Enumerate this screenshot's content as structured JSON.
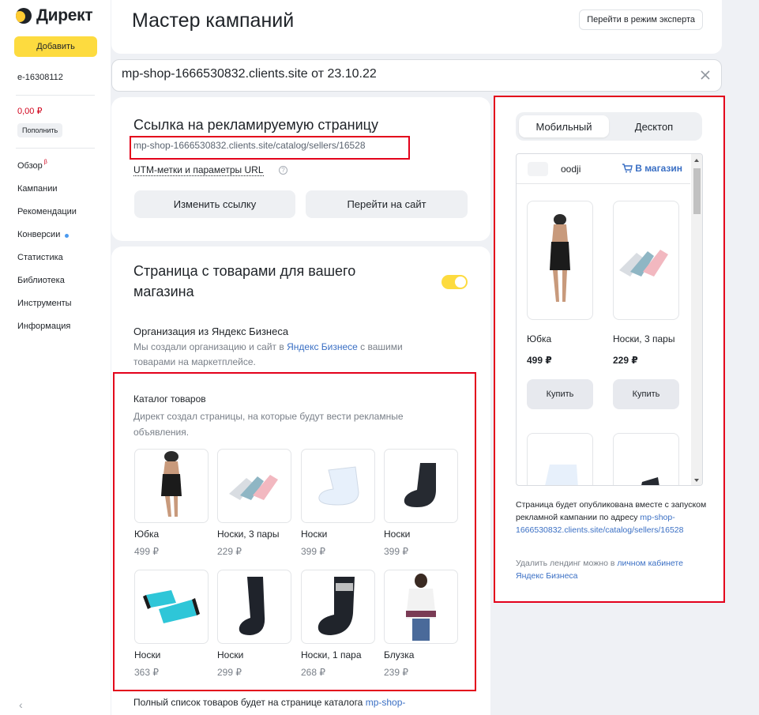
{
  "sidebar": {
    "logo": "Директ",
    "add_button": "Добавить",
    "login": "e-16308112",
    "balance": "0,00 ₽",
    "topup_button": "Пополнить",
    "nav": [
      {
        "label": "Обзор",
        "badge": "β"
      },
      {
        "label": "Кампании"
      },
      {
        "label": "Рекомендации"
      },
      {
        "label": "Конверсии",
        "dot": true
      },
      {
        "label": "Статистика"
      },
      {
        "label": "Библиотека"
      },
      {
        "label": "Инструменты"
      },
      {
        "label": "Информация"
      }
    ],
    "collapse_icon": "chevron-left-icon"
  },
  "header": {
    "title": "Мастер кампаний",
    "expert_button": "Перейти в режим эксперта"
  },
  "campaign": {
    "name": "mp-shop-1666530832.clients.site от 23.10.22"
  },
  "link_section": {
    "title": "Ссылка на рекламируемую страницу",
    "url": "mp-shop-1666530832.clients.site/catalog/sellers/16528",
    "utm": "UTM-метки и параметры URL",
    "change_button": "Изменить ссылку",
    "goto_button": "Перейти на сайт"
  },
  "shop_section": {
    "title": "Страница с товарами для вашего магазина",
    "toggle_on": true,
    "org_title": "Организация из Яндекс Бизнеса",
    "org_desc_pre": "Мы создали организацию и сайт в ",
    "org_desc_link": "Яндекс Бизнесе",
    "org_desc_post": " с вашими товарами на маркетплейсе.",
    "catalog_title": "Каталог товаров",
    "catalog_desc": "Директ создал страницы, на которые будут вести рекламные объявления.",
    "items": [
      {
        "name": "Юбка",
        "price": "499 ₽"
      },
      {
        "name": "Носки, 3 пары",
        "price": "229 ₽"
      },
      {
        "name": "Носки",
        "price": "399 ₽"
      },
      {
        "name": "Носки",
        "price": "399 ₽"
      },
      {
        "name": "Носки",
        "price": "363 ₽"
      },
      {
        "name": "Носки",
        "price": "299 ₽"
      },
      {
        "name": "Носки, 1 пара",
        "price": "268 ₽"
      },
      {
        "name": "Блузка",
        "price": "239 ₽"
      }
    ],
    "footer_pre": "Полный список товаров будет на странице каталога ",
    "footer_link": "mp-shop-"
  },
  "preview": {
    "tab_mobile": "Мобильный",
    "tab_desktop": "Десктоп",
    "shop_name": "oodji",
    "cart_link": "В магазин",
    "items": [
      {
        "name": "Юбка",
        "price": "499 ₽",
        "buy": "Купить"
      },
      {
        "name": "Носки, 3 пары",
        "price": "229 ₽",
        "buy": "Купить"
      }
    ],
    "pub_text": "Страница будет опубликована вместе с запуском рекламной кампании по адресу",
    "pub_url": "mp-shop-1666530832.clients.site/catalog/sellers/16528",
    "del_pre": "Удалить лендинг можно в ",
    "del_link": "личном кабинете Яндекс Бизнеса"
  },
  "colors": {
    "accent_yellow": "#fddb3f",
    "link_blue": "#3a6fc4",
    "highlight_red": "#e3001b",
    "balance_red": "#d0021b"
  }
}
